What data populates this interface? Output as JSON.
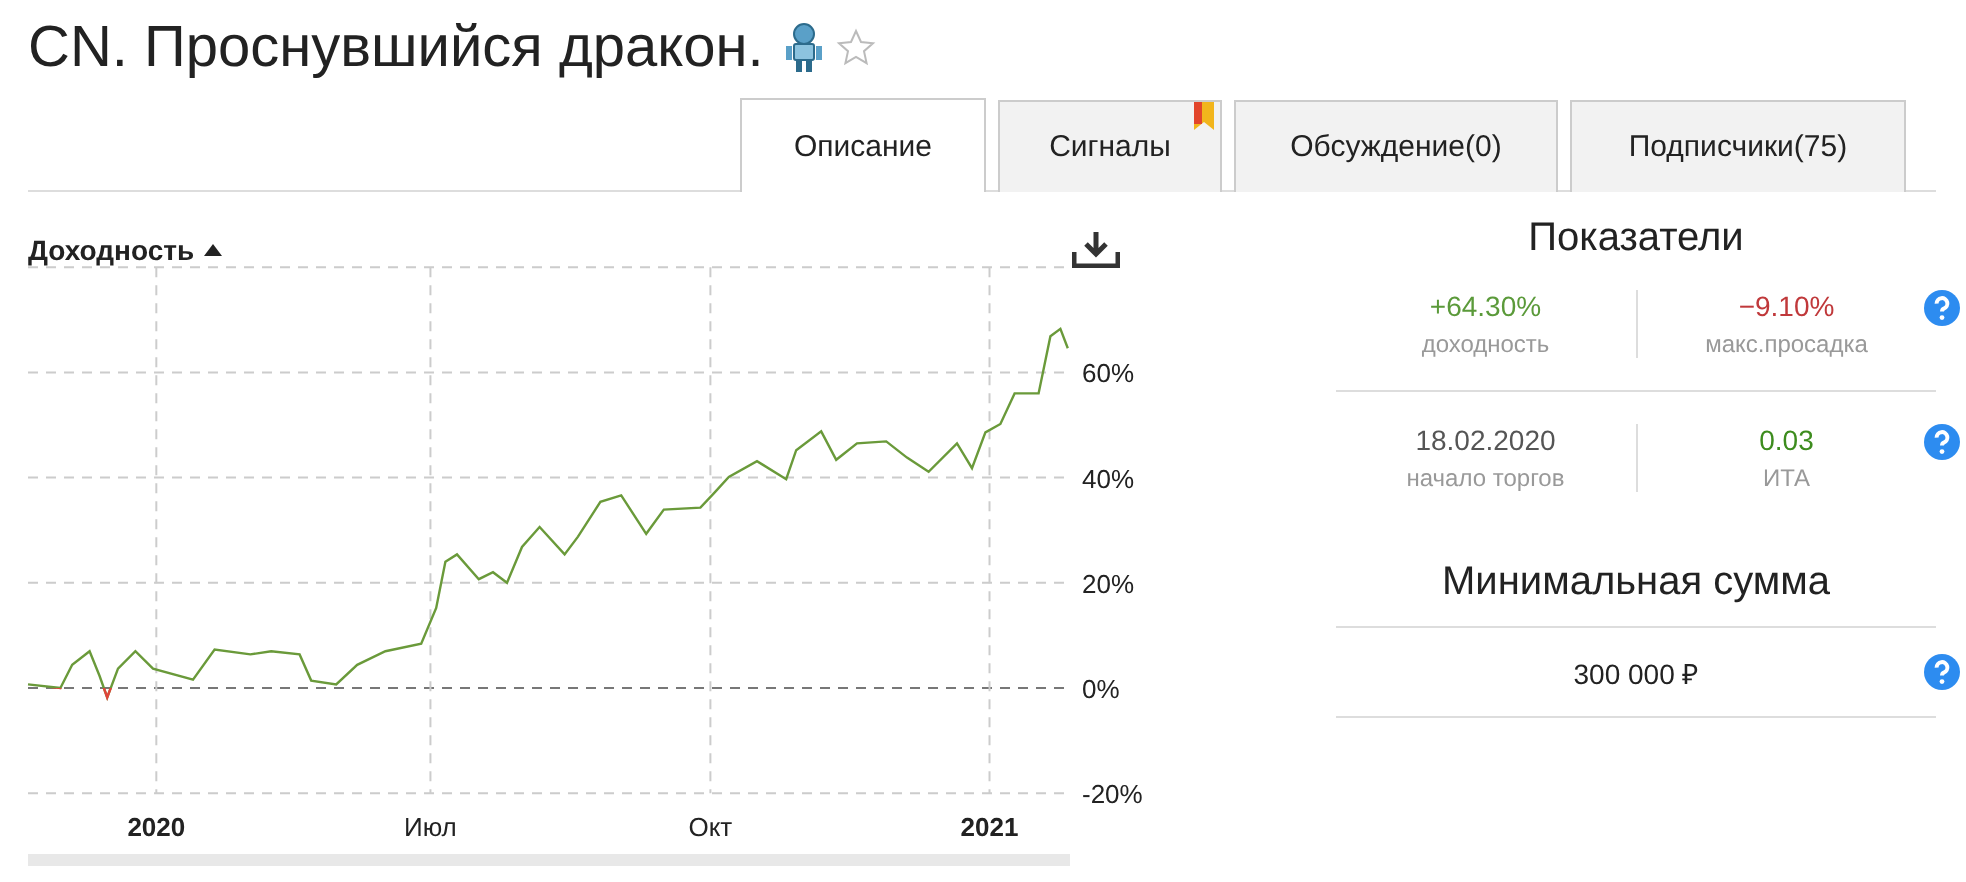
{
  "title": "CN. Проснувшийся дракон.",
  "tabs": [
    {
      "label": "Описание",
      "selected": true,
      "marked": false
    },
    {
      "label": "Сигналы",
      "selected": false,
      "marked": true
    },
    {
      "label": "Обсуждение(0)",
      "selected": false,
      "marked": false
    },
    {
      "label": "Подписчики(75)",
      "selected": false,
      "marked": false
    }
  ],
  "chart": {
    "chart_data": {
      "type": "line",
      "grid": true,
      "ref_lines": [
        {
          "axis": "y",
          "value": 0
        }
      ],
      "xlim": [
        2019.846,
        2021.099
      ],
      "ylim": [
        -20,
        80
      ],
      "xticks": [
        {
          "value": 2020,
          "label": "2020"
        },
        {
          "value": 2020.329,
          "label": "Июл"
        },
        {
          "value": 2020.665,
          "label": "Окт"
        },
        {
          "value": 2021,
          "label": "2021"
        }
      ],
      "yticks": [
        {
          "value": -20,
          "label": "-20%"
        },
        {
          "value": 0,
          "label": "0%"
        },
        {
          "value": 20,
          "label": "20%"
        },
        {
          "value": 40,
          "label": "40%"
        },
        {
          "value": 60,
          "label": "60%"
        }
      ],
      "x": [
        2019.846,
        2019.885,
        2019.899,
        2019.92,
        2019.932,
        2019.941,
        2019.954,
        2019.975,
        2019.996,
        2020.044,
        2020.07,
        2020.113,
        2020.138,
        2020.172,
        2020.186,
        2020.216,
        2020.241,
        2020.275,
        2020.318,
        2020.336,
        2020.347,
        2020.361,
        2020.387,
        2020.404,
        2020.421,
        2020.439,
        2020.46,
        2020.49,
        2020.506,
        2020.533,
        2020.558,
        2020.588,
        2020.609,
        2020.653,
        2020.669,
        2020.687,
        2020.721,
        2020.756,
        2020.768,
        2020.798,
        2020.816,
        2020.841,
        2020.876,
        2020.901,
        2020.927,
        2020.961,
        2020.979,
        2020.995,
        2021.013,
        2021.03,
        2021.059,
        2021.073,
        2021.085,
        2021.094
      ],
      "series": [
        {
          "name": "Доходность",
          "color": "#6a9a3a",
          "values": [
            0.7,
            0,
            4.4,
            7,
            2.3,
            -1.8,
            3.7,
            7,
            3.7,
            1.6,
            7.3,
            6.4,
            7,
            6.4,
            1.4,
            0.7,
            4.4,
            7,
            8.4,
            15.2,
            24,
            25.4,
            20.7,
            22,
            20,
            26.8,
            30.6,
            25.4,
            28.8,
            35.4,
            36.6,
            29.3,
            33.9,
            34.3,
            37,
            40.1,
            43.1,
            39.7,
            45.2,
            48.8,
            43.4,
            46.5,
            46.9,
            43.8,
            41.1,
            46.5,
            41.8,
            48.6,
            50.2,
            56,
            56,
            66.9,
            68.3,
            64.6
          ]
        }
      ]
    }
  },
  "metrics": {
    "heading": "Показатели",
    "rows": [
      [
        {
          "value": "+64.30%",
          "caption": "доходность",
          "color": "#5b9a3a"
        },
        {
          "value": "−9.10%",
          "caption": "макс.просадка",
          "color": "#c0393b"
        }
      ],
      [
        {
          "value": "18.02.2020",
          "caption": "начало торгов",
          "color": "#555555"
        },
        {
          "value": "0.03",
          "caption": "ИТА",
          "color": "#3d8c1e"
        }
      ]
    ]
  },
  "minimum": {
    "heading": "Минимальная сумма",
    "value": "300 000 ₽"
  }
}
